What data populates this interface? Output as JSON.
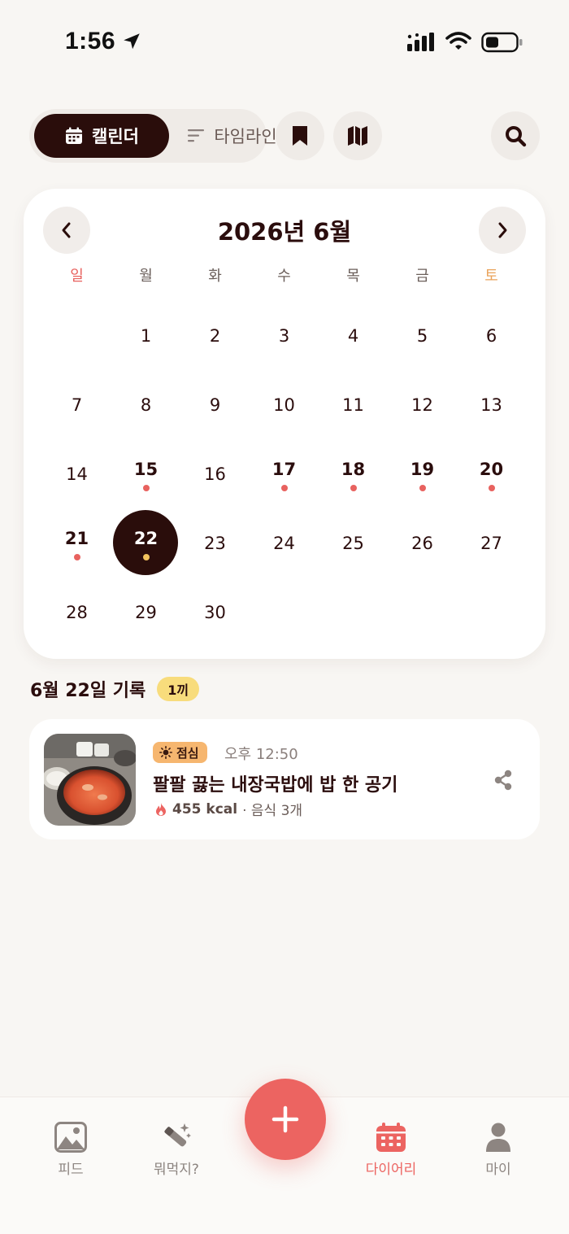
{
  "status_bar": {
    "time": "1:56",
    "icons": [
      "location-arrow-icon",
      "signal-icon",
      "wifi-icon",
      "battery-icon"
    ]
  },
  "toolbar": {
    "calendar_label": "캘린더",
    "timeline_label": "타임라인",
    "icons": [
      "calendar-icon",
      "timeline-icon",
      "bookmark-icon",
      "map-icon",
      "search-icon"
    ]
  },
  "calendar": {
    "title": "2026년 6월",
    "weekdays": [
      "일",
      "월",
      "화",
      "수",
      "목",
      "금",
      "토"
    ],
    "days": [
      [
        "",
        "1",
        "2",
        "3",
        "4",
        "5",
        "6"
      ],
      [
        "7",
        "8",
        "9",
        "10",
        "11",
        "12",
        "13"
      ],
      [
        "14",
        "15",
        "16",
        "17",
        "18",
        "19",
        "20"
      ],
      [
        "21",
        "22",
        "23",
        "24",
        "25",
        "26",
        "27"
      ],
      [
        "28",
        "29",
        "30",
        "",
        "",
        "",
        ""
      ]
    ],
    "record_days": [
      "15",
      "17",
      "18",
      "19",
      "20",
      "21",
      "22"
    ],
    "selected_day": "22"
  },
  "records": {
    "title": "6월 22일 기록",
    "count": "1끼",
    "items": [
      {
        "meal": "점심",
        "time": "오후 12:50",
        "title": "팔팔 끓는 내장국밥에 밥 한 공기",
        "kcal": "455 kcal",
        "foods": "· 음식 3개"
      }
    ]
  },
  "bottom_nav": {
    "items": [
      {
        "label": "피드",
        "icon": "image-icon"
      },
      {
        "label": "뭐먹지?",
        "icon": "magic-wand-icon"
      },
      {
        "label": "다이어리",
        "icon": "calendar-icon"
      },
      {
        "label": "마이",
        "icon": "person-icon"
      }
    ],
    "active": "다이어리"
  },
  "colors": {
    "accent": "#ec6461",
    "dark": "#2a0d0b",
    "highlight": "#f8dc7c",
    "meal_tag": "#f6b66f",
    "background": "#f8f6f3"
  }
}
